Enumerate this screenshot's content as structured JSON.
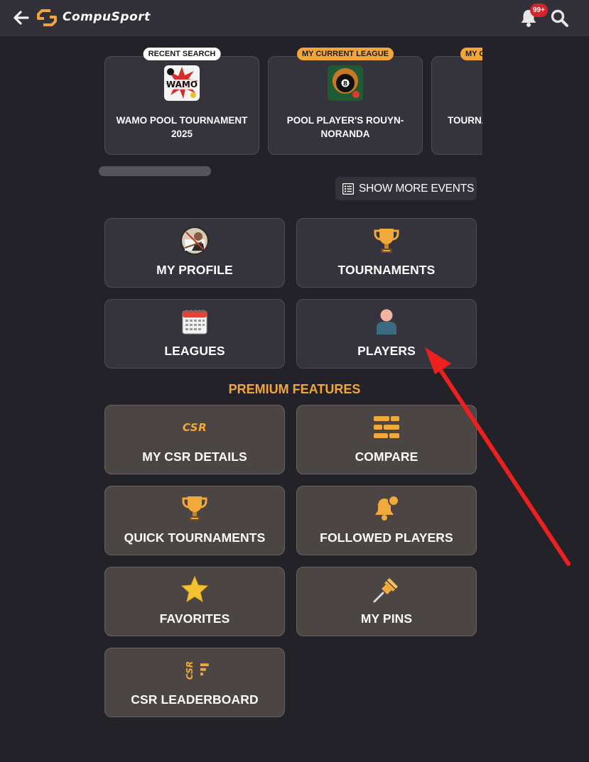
{
  "header": {
    "brand": "CompuSport",
    "notification_count": "99+",
    "accent_color": "#f2a63a"
  },
  "events": [
    {
      "tag": "RECENT SEARCH",
      "title": "WAMO POOL TOURNAMENT 2025",
      "thumb_text": "WAMO"
    },
    {
      "tag": "MY CURRENT LEAGUE",
      "title": "POOL PLAYER'S ROUYN-NORANDA",
      "thumb_text": ""
    },
    {
      "tag": "MY CURRENT LEAGUE",
      "title": "TOURNAMENT CO",
      "thumb_text": ""
    }
  ],
  "show_more_label": "SHOW MORE EVENTS",
  "main_tiles": [
    {
      "label": "MY PROFILE",
      "icon": "profile-photo-icon"
    },
    {
      "label": "TOURNAMENTS",
      "icon": "trophy-icon"
    },
    {
      "label": "LEAGUES",
      "icon": "calendar-icon"
    },
    {
      "label": "PLAYERS",
      "icon": "player-icon"
    }
  ],
  "premium_heading": "PREMIUM FEATURES",
  "premium_tiles": [
    {
      "label": "MY CSR DETAILS",
      "icon": "csr-icon",
      "icon_text": "CSR"
    },
    {
      "label": "COMPARE",
      "icon": "compare-bars-icon"
    },
    {
      "label": "QUICK TOURNAMENTS",
      "icon": "trophy-icon"
    },
    {
      "label": "FOLLOWED PLAYERS",
      "icon": "bell-notification-icon"
    },
    {
      "label": "FAVORITES",
      "icon": "star-icon"
    },
    {
      "label": "MY PINS",
      "icon": "pushpin-icon"
    },
    {
      "label": "CSR LEADERBOARD",
      "icon": "csr-leaderboard-icon",
      "icon_text": "CSR"
    }
  ]
}
